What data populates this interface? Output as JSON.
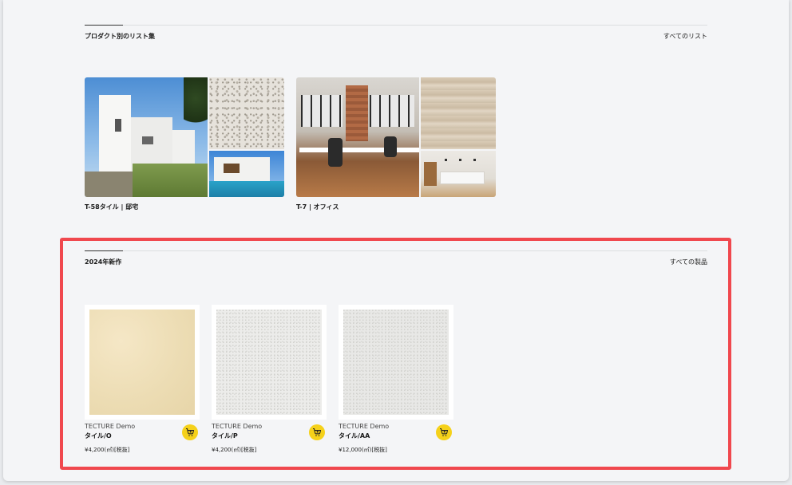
{
  "section_lists": {
    "title": "プロダクト別のリスト集",
    "link": "すべてのリスト"
  },
  "collections": [
    {
      "label": "T-58タイル | 邸宅"
    },
    {
      "label": "T-7 | オフィス"
    }
  ],
  "section_new": {
    "title": "2024年新作",
    "link": "すべての製品"
  },
  "products": [
    {
      "brand": "TECTURE Demo",
      "name": "タイル/O",
      "price": "¥4,200(㎡)[税抜]"
    },
    {
      "brand": "TECTURE Demo",
      "name": "タイル/P",
      "price": "¥4,200(㎡)[税抜]"
    },
    {
      "brand": "TECTURE Demo",
      "name": "タイル/AA",
      "price": "¥12,000(㎡)[税抜]"
    }
  ],
  "colors": {
    "accent_highlight": "#f0484e",
    "cart_button": "#f5d11a",
    "page_bg": "#f4f5f7"
  },
  "icons": {
    "cart": "cart-plus-icon"
  }
}
